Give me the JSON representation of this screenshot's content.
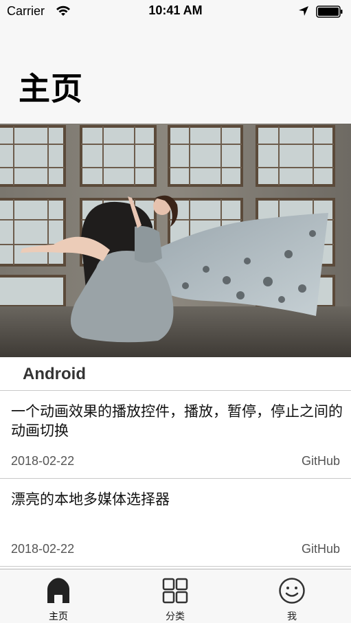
{
  "status_bar": {
    "carrier": "Carrier",
    "time": "10:41 AM"
  },
  "header": {
    "title": "主页"
  },
  "section": {
    "title": "Android"
  },
  "items": [
    {
      "title": "一个动画效果的播放控件，播放，暂停，停止之间的动画切换",
      "date": "2018-02-22",
      "source": "GitHub"
    },
    {
      "title": "漂亮的本地多媒体选择器",
      "date": "2018-02-22",
      "source": "GitHub"
    }
  ],
  "tabs": [
    {
      "label": "主页",
      "icon": "home-icon",
      "active": true
    },
    {
      "label": "分类",
      "icon": "grid-icon",
      "active": false
    },
    {
      "label": "我",
      "icon": "smiley-icon",
      "active": false
    }
  ],
  "colors": {
    "bar_background": "#f7f7f7",
    "divider": "#c8c8c8",
    "text_primary": "#111111",
    "text_secondary": "#555555"
  }
}
